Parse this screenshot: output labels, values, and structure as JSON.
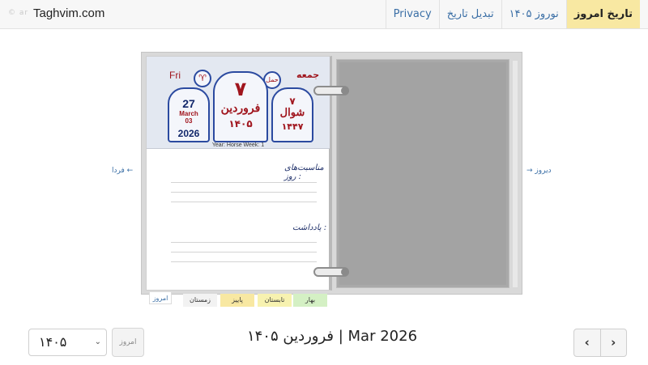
{
  "brand": {
    "title": "Taghvim.com",
    "faint_text": "© ar"
  },
  "nav": {
    "items": [
      {
        "label": "Privacy"
      },
      {
        "label": "تبدیل تاریخ"
      },
      {
        "label": "نوروز ۱۴۰۵"
      },
      {
        "label": "تاریخ امروز"
      }
    ],
    "active_color": "#f8e8a2",
    "link_color": "#3b6fa6"
  },
  "calendar": {
    "weekday_en": "Fri",
    "weekday_fa": "جمعه",
    "zodiac_symbol": "♈",
    "zodiac_fa": "حمل",
    "gregorian": {
      "day": "27",
      "month": "March",
      "month_num": "03",
      "year": "2026"
    },
    "persian": {
      "day": "۷",
      "month": "فروردین",
      "year": "۱۴۰۵"
    },
    "hijri": {
      "day": "۷",
      "month": "شوال",
      "year": "۱۴۴۷"
    },
    "meta": "Year: Horse   Week: 1",
    "occasions_label": "مناسبت‌های روز :",
    "notes_label": "یادداشت :",
    "accent_red": "#a0151d",
    "accent_navy": "#2b4aa0"
  },
  "side_nav": {
    "tomorrow": "فردا ←",
    "yesterday": "→ دیروز"
  },
  "seasons": [
    {
      "label": "امروز",
      "color": "#ffffff"
    },
    {
      "label": "زمستان",
      "color": "#f2f2f2"
    },
    {
      "label": "پاییز",
      "color": "#f8e8a2"
    },
    {
      "label": "تابستان",
      "color": "#f7f2b0"
    },
    {
      "label": "بهار",
      "color": "#d4f0c4"
    }
  ],
  "footer": {
    "title": "فروردین ۱۴۰۵ | Mar 2026",
    "year_select": "۱۴۰۵",
    "today_button": "امروز",
    "prev_icon": "‹",
    "next_icon": "›"
  }
}
